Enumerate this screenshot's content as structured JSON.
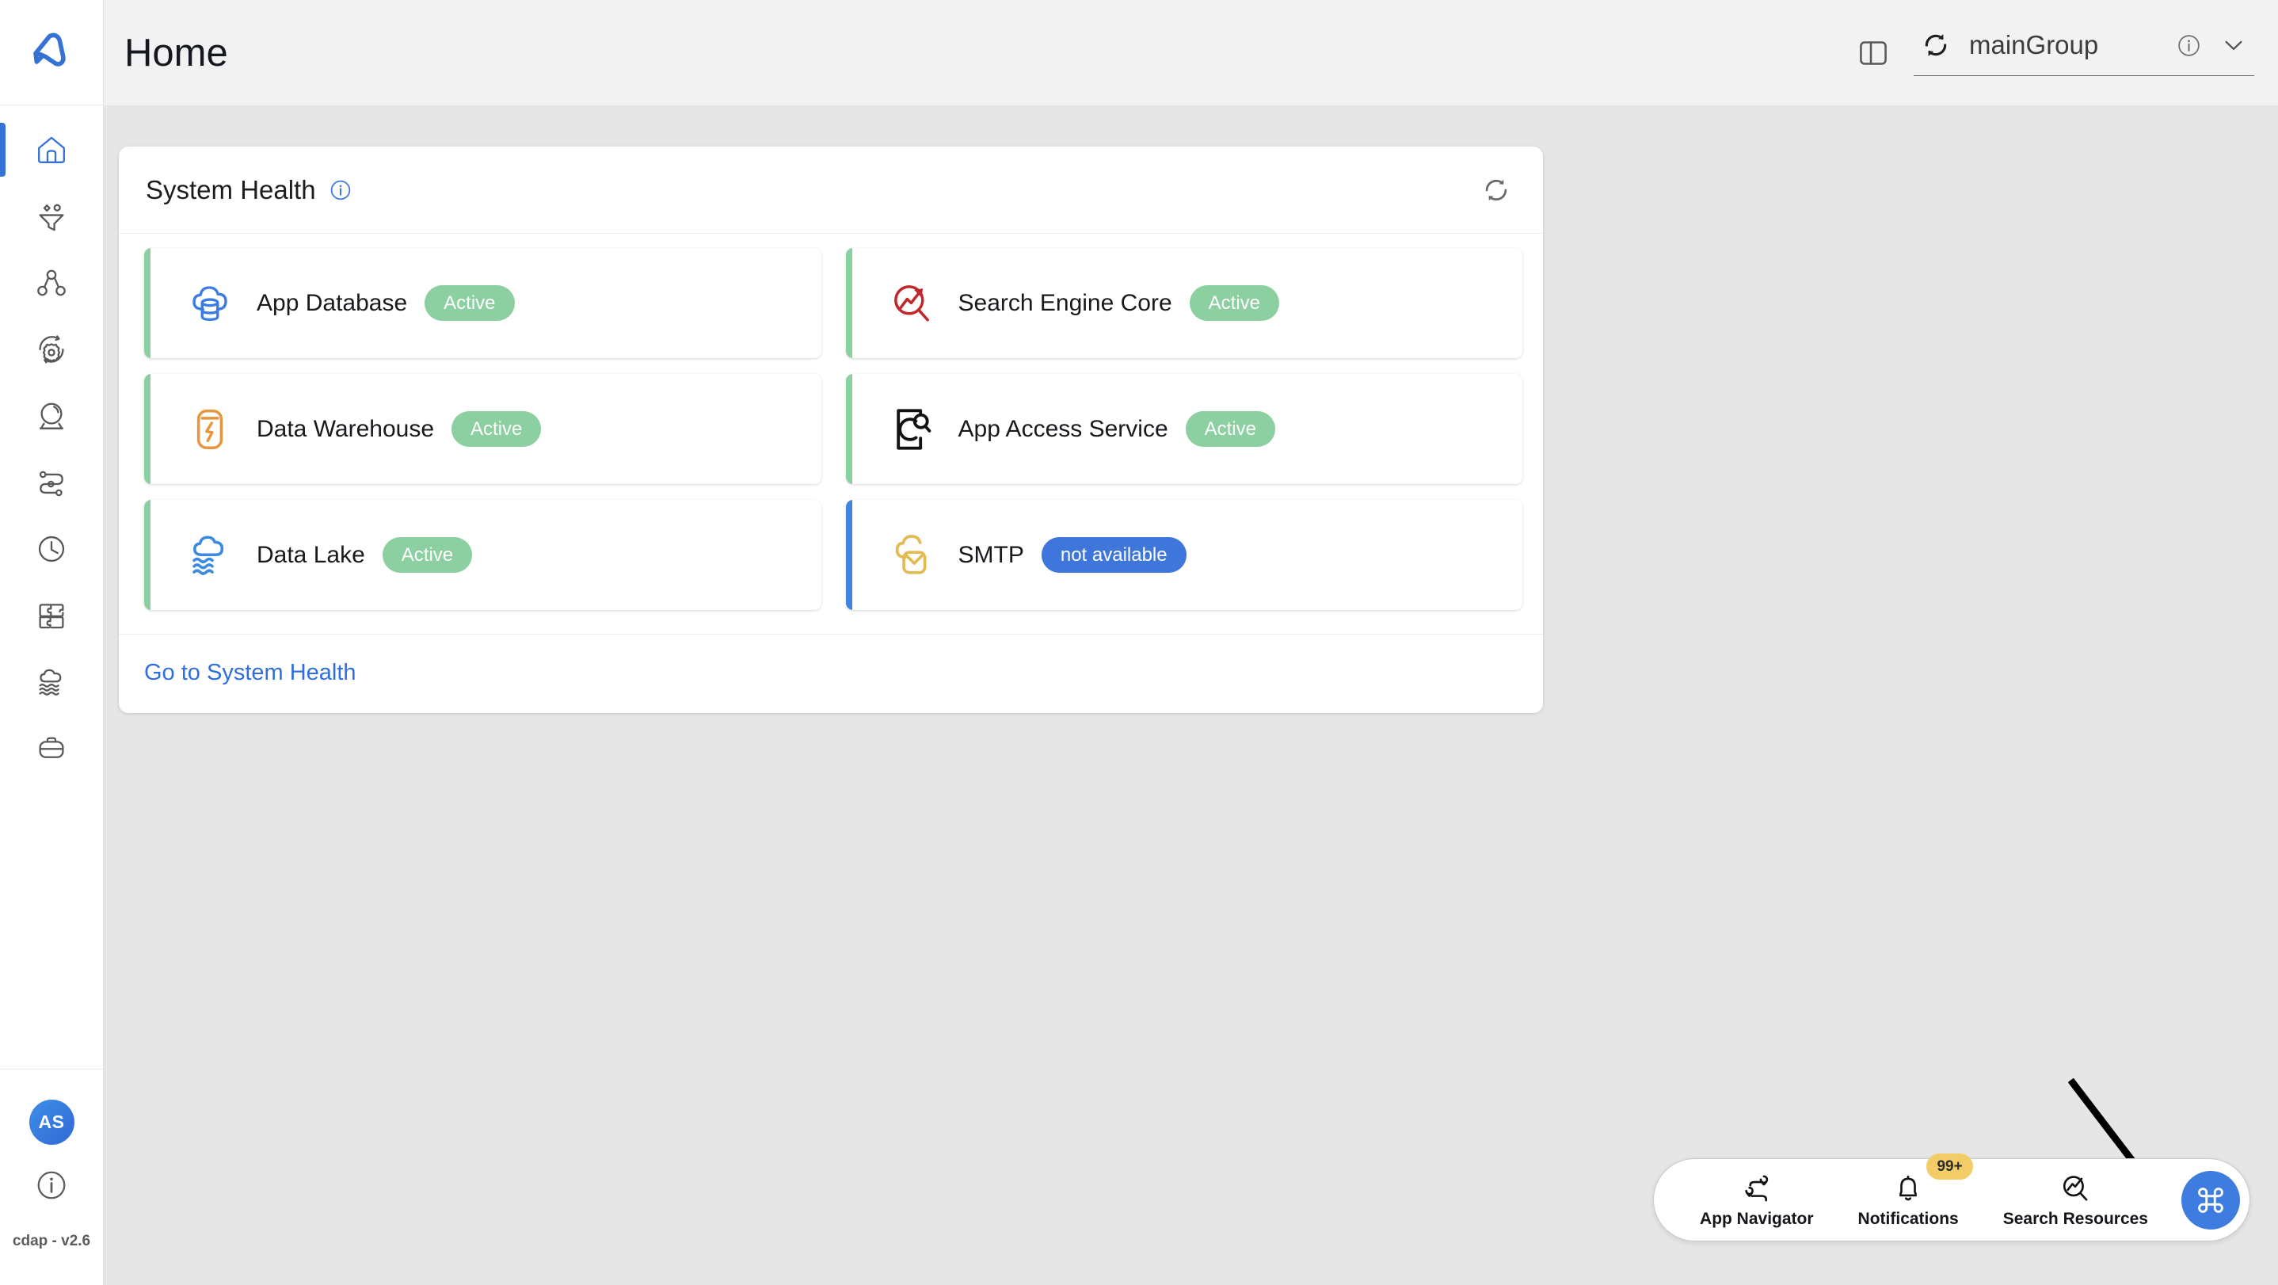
{
  "app": {
    "logo_icon": "cdap-logo-icon",
    "version": "cdap - v2.6",
    "avatar_initials": "AS"
  },
  "header": {
    "title": "Home",
    "panel_toggle_icon": "panel-toggle-icon",
    "group_refresh_icon": "refresh-icon",
    "group_name": "mainGroup",
    "group_info_icon": "info-icon",
    "group_chevron_icon": "chevron-down-icon"
  },
  "sidebar": {
    "items": [
      {
        "name": "home",
        "icon": "home-icon",
        "active": true
      },
      {
        "name": "ingestion",
        "icon": "funnel-icon",
        "active": false
      },
      {
        "name": "pipelines",
        "icon": "hierarchy-nodes-icon",
        "active": false
      },
      {
        "name": "operations",
        "icon": "gear-refresh-icon",
        "active": false
      },
      {
        "name": "insights",
        "icon": "crystal-ball-icon",
        "active": false
      },
      {
        "name": "workflow",
        "icon": "route-path-icon",
        "active": false
      },
      {
        "name": "scheduler",
        "icon": "clock-icon",
        "active": false
      },
      {
        "name": "plugins",
        "icon": "puzzle-icon",
        "active": false
      },
      {
        "name": "data-lake",
        "icon": "cloud-waves-icon",
        "active": false
      },
      {
        "name": "projects",
        "icon": "briefcase-icon",
        "active": false
      }
    ],
    "info_icon": "info-icon"
  },
  "health_card": {
    "title": "System Health",
    "title_info_icon": "info-icon",
    "refresh_icon": "refresh-icon",
    "footer_link": "Go to System Health",
    "items": [
      {
        "label": "App Database",
        "status": "Active",
        "status_color": "#8ccfa1",
        "accent": "green",
        "icon": "cloud-database-icon"
      },
      {
        "label": "Search Engine Core",
        "status": "Active",
        "status_color": "#8ccfa1",
        "accent": "green",
        "icon": "search-trend-icon"
      },
      {
        "label": "Data Warehouse",
        "status": "Active",
        "status_color": "#8ccfa1",
        "accent": "green",
        "icon": "warehouse-bolt-icon"
      },
      {
        "label": "App Access Service",
        "status": "Active",
        "status_color": "#8ccfa1",
        "accent": "green",
        "icon": "phone-search-icon"
      },
      {
        "label": "Data Lake",
        "status": "Active",
        "status_color": "#8ccfa1",
        "accent": "green",
        "icon": "cloud-waves-icon"
      },
      {
        "label": "SMTP",
        "status": "not available",
        "status_color": "#3f76dc",
        "accent": "blue",
        "icon": "cloud-mail-icon"
      }
    ]
  },
  "fab_bar": {
    "items": [
      {
        "label": "App Navigator",
        "icon": "route-pin-icon",
        "badge": null
      },
      {
        "label": "Notifications",
        "icon": "bell-icon",
        "badge": "99+"
      },
      {
        "label": "Search Resources",
        "icon": "search-trend-icon",
        "badge": null
      }
    ],
    "command_button_icon": "command-key-icon"
  },
  "annotation": {
    "arrow_icon": "annotation-arrow-icon"
  },
  "colors": {
    "accent_blue": "#3572d4",
    "status_green": "#8ccfa1",
    "status_blue": "#3f76dc",
    "badge_yellow": "#f2cd67",
    "link_blue": "#2f6fdc",
    "page_bg": "#e6e6e6",
    "header_bg": "#f2f2f2"
  }
}
